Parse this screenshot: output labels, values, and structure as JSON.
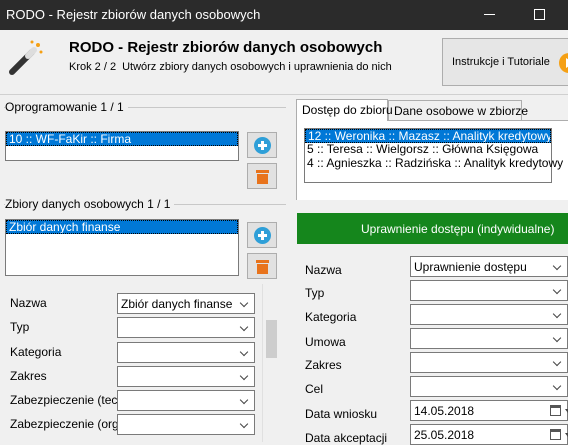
{
  "window": {
    "title": "RODO - Rejestr zbiorów danych osobowych"
  },
  "header": {
    "title": "RODO - Rejestr zbiorów danych osobowych",
    "step": "Krok 2 / 2",
    "step_description": "Utwórz zbiory danych osobowych i uprawnienia do nich",
    "tutorial_button": "Instrukcje i Tutoriale"
  },
  "left": {
    "software_group": {
      "label": "Oprogramowanie 1 / 1",
      "items": [
        "10 :: WF-FaKir :: Firma"
      ]
    },
    "datasets_group": {
      "label": "Zbiory danych osobowych 1 / 1",
      "items": [
        "Zbiór danych finanse"
      ]
    },
    "form": {
      "fields": [
        {
          "label": "Nazwa",
          "value": "Zbiór danych finanse"
        },
        {
          "label": "Typ",
          "value": ""
        },
        {
          "label": "Kategoria",
          "value": ""
        },
        {
          "label": "Zakres",
          "value": ""
        },
        {
          "label": "Zabezpieczenie (tech)",
          "value": ""
        },
        {
          "label": "Zabezpieczenie (org)",
          "value": ""
        }
      ]
    }
  },
  "right": {
    "tabs": [
      {
        "label": "Dostęp do zbioru",
        "active": true
      },
      {
        "label": "Dane osobowe w zbiorze",
        "active": false
      }
    ],
    "access_list": [
      "12 :: Weronika :: Mazasz :: Analityk kredytowy",
      "5 :: Teresa :: Wielgorsz :: Główna Księgowa",
      "4 :: Agnieszka :: Radzińska :: Analityk kredytowy"
    ],
    "section_title": "Uprawnienie dostępu (indywidualne)",
    "form": {
      "fields": [
        {
          "label": "Nazwa",
          "value": "Uprawnienie dostępu"
        },
        {
          "label": "Typ",
          "value": ""
        },
        {
          "label": "Kategoria",
          "value": ""
        },
        {
          "label": "Umowa",
          "value": ""
        },
        {
          "label": "Zakres",
          "value": ""
        },
        {
          "label": "Cel",
          "value": ""
        },
        {
          "label": "Data wniosku",
          "value": "14.05.2018"
        },
        {
          "label": "Data akceptacji",
          "value": "25.05.2018"
        }
      ]
    }
  },
  "colors": {
    "selection": "#0078d7",
    "green_bar": "#15861c",
    "add_icon": "#2e9fd8",
    "trash_icon": "#e8731c",
    "titlebar": "#2b2b2b"
  }
}
